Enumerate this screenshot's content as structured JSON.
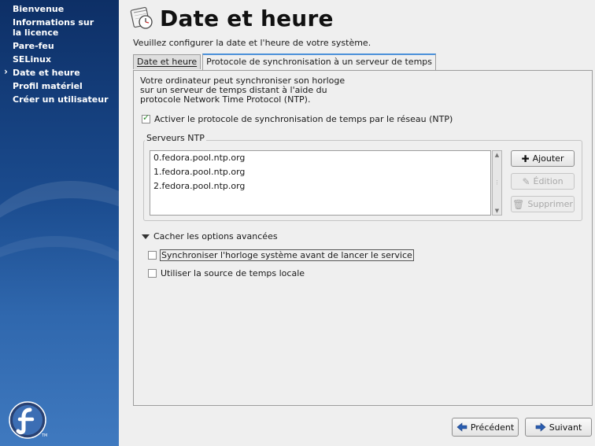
{
  "sidebar": {
    "items": [
      {
        "label": "Bienvenue"
      },
      {
        "label": "Informations sur la licence"
      },
      {
        "label": "Pare-feu"
      },
      {
        "label": "SELinux"
      },
      {
        "label": "Date et heure",
        "current": true
      },
      {
        "label": "Profil matériel"
      },
      {
        "label": "Créer un utilisateur"
      }
    ],
    "logo_tm": "TM"
  },
  "header": {
    "title": "Date et heure"
  },
  "intro": "Veuillez configurer la date et l'heure de votre système.",
  "tabs": [
    {
      "label": "Date et heure",
      "active": false
    },
    {
      "label": "Protocole de synchronisation à un serveur de temps",
      "active": true
    }
  ],
  "ntp": {
    "description": "Votre ordinateur peut synchroniser son horloge sur un serveur de temps distant à l'aide du protocole Network Time Protocol (NTP).",
    "enable_label": "Activer le protocole de synchronisation de temps par le réseau (NTP)",
    "enable_checked": true,
    "servers_label": "Serveurs NTP",
    "servers": [
      "0.fedora.pool.ntp.org",
      "1.fedora.pool.ntp.org",
      "2.fedora.pool.ntp.org"
    ],
    "add_button": "Ajouter",
    "edit_button": "Édition",
    "delete_button": "Supprimer",
    "advanced_toggle": "Cacher les options avancées",
    "sync_before_label": "Synchroniser l'horloge système avant de lancer le service",
    "sync_before_checked": false,
    "local_source_label": "Utiliser la source de temps locale",
    "local_source_checked": false
  },
  "footer": {
    "back_button": "Précédent",
    "next_button": "Suivant"
  },
  "colors": {
    "sidebar_top": "#0d2f66",
    "sidebar_bottom": "#3f79bf",
    "tab_accent": "#4a90d9",
    "nav_arrow": "#2a5db0"
  }
}
